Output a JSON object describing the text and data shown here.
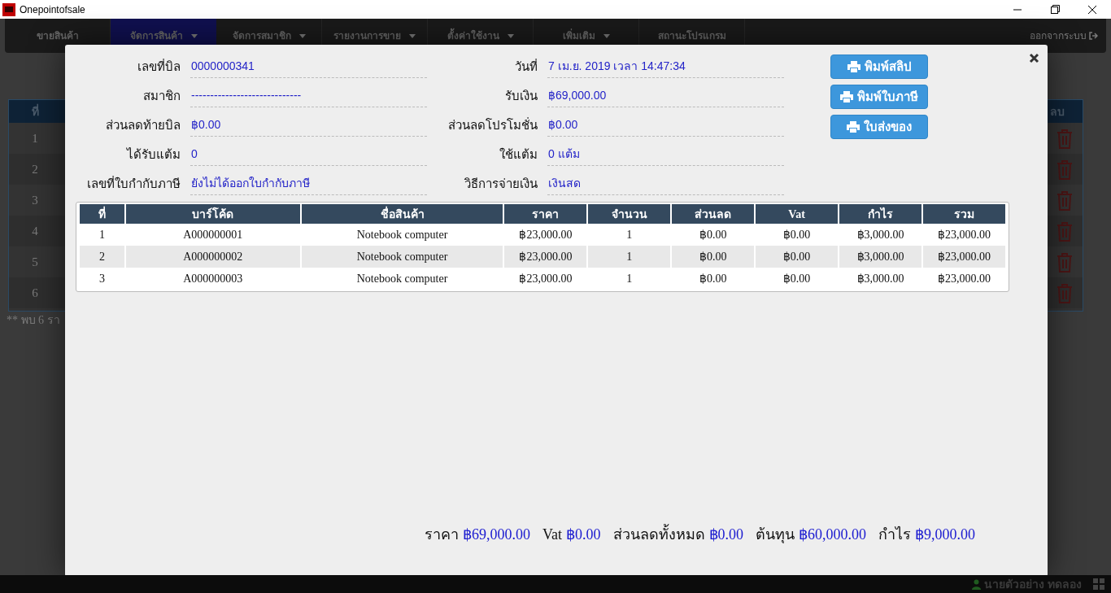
{
  "window": {
    "title": "Onepointofsale"
  },
  "navbar": {
    "items": [
      {
        "label": "ขายสินค้า",
        "selected": false,
        "has_caret": false
      },
      {
        "label": "จัดการสินค้า",
        "selected": true,
        "has_caret": true
      },
      {
        "label": "จัดการสมาชิก",
        "selected": false,
        "has_caret": true
      },
      {
        "label": "รายงานการขาย",
        "selected": false,
        "has_caret": true
      },
      {
        "label": "ตั้งค่าใช้งาน",
        "selected": false,
        "has_caret": true
      },
      {
        "label": "เพิ่มเติม",
        "selected": false,
        "has_caret": true
      },
      {
        "label": "สถานะโปรแกรม",
        "selected": false,
        "has_caret": false
      }
    ],
    "logout": "ออกจากระบบ"
  },
  "background_table": {
    "columns": [
      "ที่",
      "ลบ"
    ],
    "rows": [
      "1",
      "2",
      "3",
      "4",
      "5",
      "6"
    ],
    "found_text": "** พบ 6 รา"
  },
  "bill": {
    "left_fields": [
      {
        "label": "เลขที่บิล",
        "value": "0000000341"
      },
      {
        "label": "สมาชิก",
        "value": "-----------------------------"
      },
      {
        "label": "ส่วนลดท้ายบิล",
        "value": "฿0.00"
      },
      {
        "label": "ได้รับแต้ม",
        "value": "0"
      },
      {
        "label": "เลขที่ใบกำกับภาษี",
        "value": "ยังไม่ได้ออกใบกำกับภาษี"
      }
    ],
    "right_fields": [
      {
        "label": "วันที่",
        "value": "7  เม.ย. 2019 เวลา 14:47:34"
      },
      {
        "label": "รับเงิน",
        "value": "฿69,000.00"
      },
      {
        "label": "ส่วนลดโปรโมชั่น",
        "value": "฿0.00"
      },
      {
        "label": "ใช้แต้ม",
        "value": "0 แต้ม"
      },
      {
        "label": "วิธีการจ่ายเงิน",
        "value": "เงินสด"
      }
    ],
    "buttons": [
      "พิมพ์สลิป",
      "พิมพ์ใบภาษี",
      "ใบส่งของ"
    ],
    "table": {
      "columns": [
        "ที่",
        "บาร์โค้ด",
        "ชื่อสินค้า",
        "ราคา",
        "จำนวน",
        "ส่วนลด",
        "Vat",
        "กำไร",
        "รวม"
      ],
      "rows": [
        [
          "1",
          "A000000001",
          "Notebook computer",
          "฿23,000.00",
          "1",
          "฿0.00",
          "฿0.00",
          "฿3,000.00",
          "฿23,000.00"
        ],
        [
          "2",
          "A000000002",
          "Notebook computer",
          "฿23,000.00",
          "1",
          "฿0.00",
          "฿0.00",
          "฿3,000.00",
          "฿23,000.00"
        ],
        [
          "3",
          "A000000003",
          "Notebook computer",
          "฿23,000.00",
          "1",
          "฿0.00",
          "฿0.00",
          "฿3,000.00",
          "฿23,000.00"
        ]
      ]
    },
    "totals": [
      {
        "label": "ราคา",
        "value": "฿69,000.00"
      },
      {
        "label": "Vat",
        "value": "฿0.00"
      },
      {
        "label": "ส่วนลดทั้งหมด",
        "value": "฿0.00"
      },
      {
        "label": "ต้นทุน",
        "value": "฿60,000.00"
      },
      {
        "label": "กำไร",
        "value": "฿9,000.00"
      }
    ]
  },
  "status_bar": {
    "user": "นายตัวอย่าง ทดลอง"
  }
}
